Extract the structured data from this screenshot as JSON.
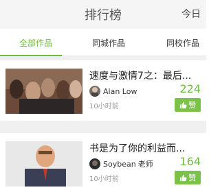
{
  "header": {
    "title": "排行榜",
    "right_label": "今日"
  },
  "tabs": [
    {
      "label": "全部作品",
      "active": true
    },
    {
      "label": "同城作品",
      "active": false
    },
    {
      "label": "同校作品",
      "active": false
    }
  ],
  "items": [
    {
      "title": "速度与激情7之：最后...",
      "author": "Alan Low",
      "role": "",
      "time": "10小时前",
      "likes": "224",
      "like_label": "赞"
    },
    {
      "title": "书是为了你的利益而...",
      "author": "Soybean",
      "role": "老师",
      "time": "10小时前",
      "likes": "164",
      "like_label": "赞"
    }
  ],
  "colors": {
    "accent": "#6cbd3b",
    "like_button": "#7cc24a"
  },
  "icons": {
    "like": "thumbs-up-icon"
  }
}
